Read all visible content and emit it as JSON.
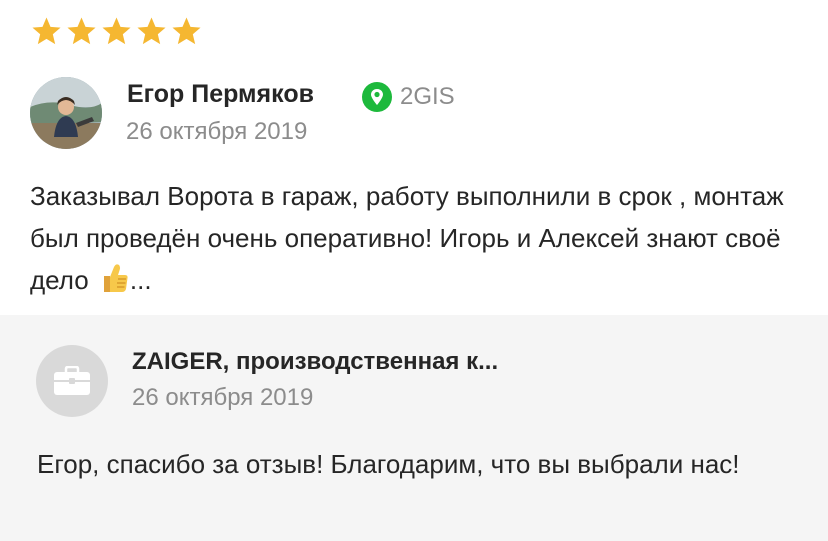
{
  "review": {
    "rating": 5,
    "rating_max": 5,
    "star_color": "#f5b731",
    "author": {
      "name": "Егор Пермяков",
      "avatar": "user-photo"
    },
    "source": {
      "icon": "2gis-pin-icon",
      "label": "2GIS",
      "color": "#1db93c"
    },
    "date": "26 октября 2019",
    "text": "Заказывал Ворота в гараж, работу выполнили в срок , монтаж был проведён очень оперативно! Игорь и Алексей знают своё дело ",
    "emoji": "thumbs-up-emoji",
    "ellipsis": "..."
  },
  "reply": {
    "company_name": "ZAIGER, производственная к...",
    "company_avatar_icon": "briefcase-icon",
    "date": "26 октября 2019",
    "text": "Егор, спасибо за отзыв! Благодарим, что вы выбрали нас!",
    "background": "#f5f5f5"
  }
}
